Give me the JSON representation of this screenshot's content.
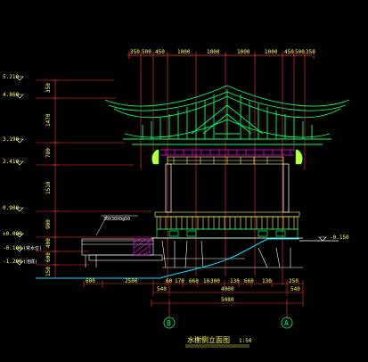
{
  "drawing": {
    "title": "水榭侧立面图",
    "scale": "1:50",
    "colors": {
      "background": "#000000",
      "text": "#ffff5a",
      "roof": "#00ff66",
      "dimension_line": "#ff3030",
      "water": "#00e0ff",
      "structure": "#ffffff",
      "detail": "#ff00ff"
    }
  },
  "top_dimensions": [
    "350",
    "500",
    "450",
    "1000",
    "1000",
    "1000",
    "1000",
    "450",
    "500",
    "350"
  ],
  "left_levels": [
    "5.210",
    "4.860",
    "3.190",
    "2.410",
    "0.900",
    "±0.000",
    "-0.100",
    "-1.200"
  ],
  "level_notes": [
    "(常水位)",
    "(池底)"
  ],
  "left_vertical_dims": [
    "350",
    "1470",
    "780",
    "1510",
    "900",
    "400",
    "600",
    "150"
  ],
  "right_level": "-0.150",
  "bottom_dims_row1": [
    "600",
    "2500",
    "60",
    "170",
    "660",
    "10",
    "300",
    "130",
    "660",
    "130",
    "250"
  ],
  "bottom_dims_row2": [
    "540",
    "4000",
    "540"
  ],
  "bottom_total": "5080",
  "note_label": "30X30X0@50",
  "axis_left": "B",
  "axis_right": "A"
}
